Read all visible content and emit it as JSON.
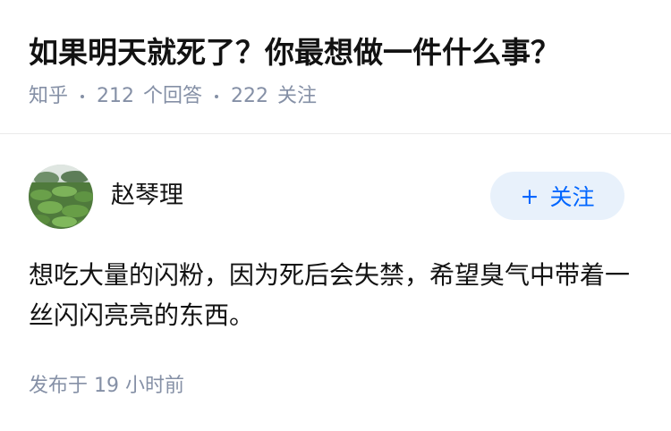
{
  "question": {
    "title": "如果明天就死了？你最想做一件什么事？",
    "source": "知乎",
    "answers_count": "212",
    "answers_label": "个回答",
    "followers_count": "222",
    "followers_label": "关注"
  },
  "answer": {
    "author_name": "赵琴理",
    "follow_button": {
      "icon": "plus-icon",
      "label": "关注"
    },
    "content": "想吃大量的闪粉，因为死后会失禁，希望臭气中带着一丝闪闪亮亮的东西。",
    "time_prefix": "发布于",
    "time_value": "19 小时前"
  },
  "colors": {
    "accent": "#0066ff",
    "meta_gray": "#8590a6",
    "follow_bg": "#e8f1fb",
    "text": "#121212"
  }
}
